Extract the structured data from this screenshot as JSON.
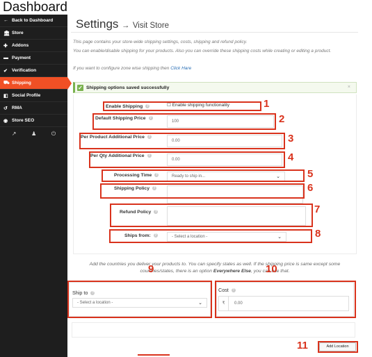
{
  "page_heading": "Dashboard",
  "sidebar": {
    "items": [
      {
        "icon": "←",
        "icon_name": "arrow-left-icon",
        "label": "Back to Dashboard"
      },
      {
        "icon": "🏛",
        "icon_name": "store-icon",
        "label": "Store"
      },
      {
        "icon": "✚",
        "icon_name": "puzzle-icon",
        "label": "Addons"
      },
      {
        "icon": "▬",
        "icon_name": "credit-card-icon",
        "label": "Payment"
      },
      {
        "icon": "✔",
        "icon_name": "check-icon",
        "label": "Verification"
      },
      {
        "icon": "⛟",
        "icon_name": "truck-icon",
        "label": "Shipping",
        "active": true
      },
      {
        "icon": "◧",
        "icon_name": "share-icon",
        "label": "Social Profile"
      },
      {
        "icon": "↺",
        "icon_name": "rma-icon",
        "label": "RMA"
      },
      {
        "icon": "◉",
        "icon_name": "globe-icon",
        "label": "Store SEO"
      }
    ],
    "footer_icons": [
      "external-link-icon",
      "user-icon",
      "power-icon"
    ],
    "footer_glyphs": [
      "↗",
      "♟",
      "⏻"
    ],
    "active_color": "#f05025",
    "bg_color": "#1e1e1e"
  },
  "header": {
    "title": "Settings",
    "arrow": "→",
    "link": "Visit Store"
  },
  "help": {
    "line1": "This page contains your store-wide shipping settings, costs, shipping and refund policy.",
    "line2": "You can enable/disable shipping for your products. Also you can override these shipping costs while creating or editing a product.",
    "line3_prefix": "If you want to configure zone wise shipping then ",
    "line3_link": "Click Hare"
  },
  "alert": {
    "message": "Shipping options saved successfully",
    "close": "×"
  },
  "form": {
    "enable_shipping": {
      "label": "Enable Shipping",
      "checkbox_label": "Enable shipping functionality",
      "checked": false
    },
    "default_price": {
      "label": "Default Shipping Price",
      "value": "100"
    },
    "per_product": {
      "label": "Per Product Additional Price",
      "value": "0.00"
    },
    "per_qty": {
      "label": "Per Qty Additional Price",
      "value": "0.00"
    },
    "processing_time": {
      "label": "Processing Time",
      "value": "Ready to ship in..."
    },
    "shipping_policy": {
      "label": "Shipping Policy",
      "value": ""
    },
    "refund_policy": {
      "label": "Refund Policy",
      "value": ""
    },
    "ships_from": {
      "label": "Ships from:",
      "value": "- Select a location -"
    }
  },
  "zone_help": {
    "prefix": "Add the countries you deliver your products to. You can specify states as well. If the shipping price is same except some countries/states, there is an option ",
    "bold": "Everywhere Else",
    "suffix": ", you can use that."
  },
  "ship_to": {
    "label": "Ship to",
    "value": "- Select a location -"
  },
  "cost": {
    "label": "Cost",
    "currency": "₹",
    "value": "0.00"
  },
  "add_location": "Add Location",
  "callouts": [
    "1",
    "2",
    "3",
    "4",
    "5",
    "6",
    "7",
    "8",
    "9",
    "10",
    "11"
  ],
  "callout_color": "#d9321c"
}
